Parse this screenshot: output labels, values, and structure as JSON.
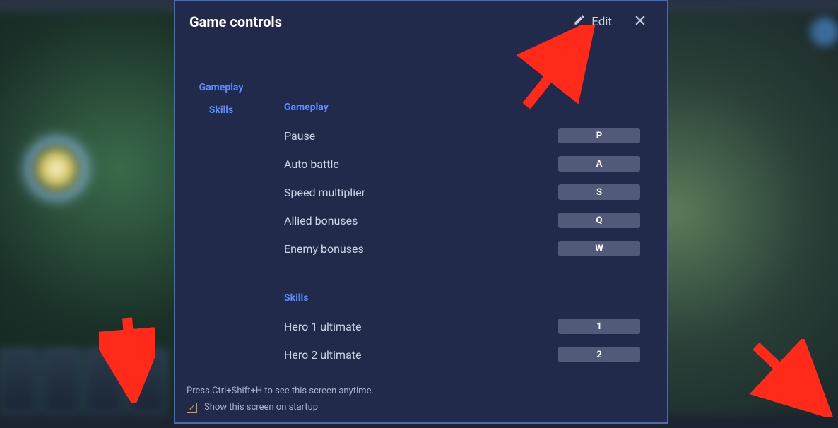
{
  "modal": {
    "title": "Game controls",
    "edit_label": "Edit"
  },
  "sidebar": {
    "items": [
      {
        "label": "Gameplay"
      },
      {
        "label": "Skills"
      }
    ]
  },
  "sections": [
    {
      "heading": "Gameplay",
      "rows": [
        {
          "label": "Pause",
          "key": "P"
        },
        {
          "label": "Auto battle",
          "key": "A"
        },
        {
          "label": "Speed multiplier",
          "key": "S"
        },
        {
          "label": "Allied bonuses",
          "key": "Q"
        },
        {
          "label": "Enemy bonuses",
          "key": "W"
        }
      ]
    },
    {
      "heading": "Skills",
      "rows": [
        {
          "label": "Hero 1 ultimate",
          "key": "1"
        },
        {
          "label": "Hero 2 ultimate",
          "key": "2"
        }
      ]
    }
  ],
  "footer": {
    "hint": "Press Ctrl+Shift+H to see this screen anytime.",
    "checkbox_label": "Show this screen on startup",
    "checkbox_checked": true
  }
}
